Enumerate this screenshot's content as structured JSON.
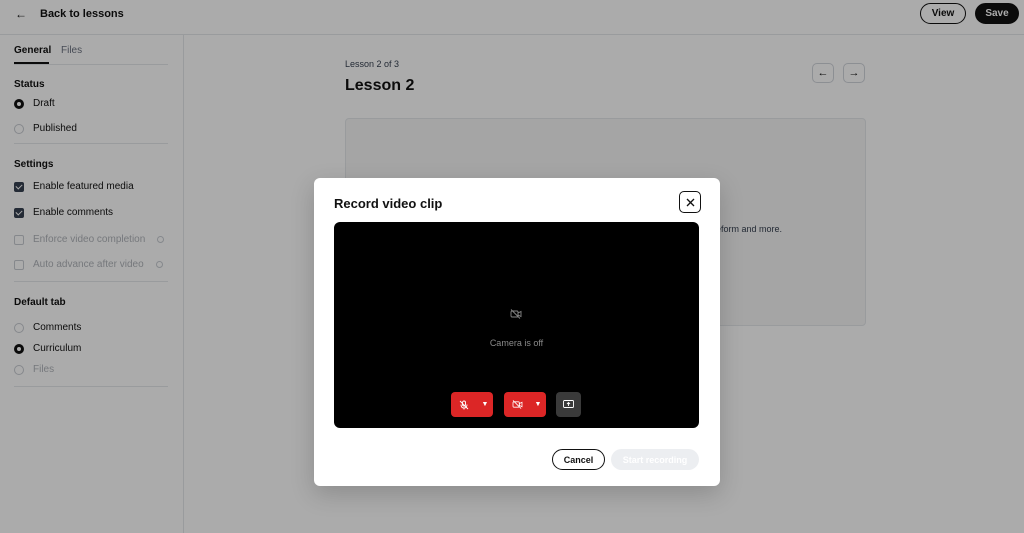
{
  "header": {
    "back_label": "Back to lessons",
    "view_label": "View",
    "save_label": "Save"
  },
  "sidebar": {
    "tabs": [
      {
        "label": "General",
        "active": true
      },
      {
        "label": "Files",
        "active": false
      }
    ],
    "status": {
      "title": "Status",
      "options": [
        {
          "label": "Draft",
          "selected": true
        },
        {
          "label": "Published",
          "selected": false
        }
      ]
    },
    "settings": {
      "title": "Settings",
      "options": [
        {
          "label": "Enable featured media",
          "checked": true,
          "disabled": false
        },
        {
          "label": "Enable comments",
          "checked": true,
          "disabled": false
        },
        {
          "label": "Enforce video completion",
          "checked": false,
          "disabled": true
        },
        {
          "label": "Auto advance after video",
          "checked": false,
          "disabled": true
        }
      ]
    },
    "default_tab": {
      "title": "Default tab",
      "options": [
        {
          "label": "Comments",
          "selected": false,
          "disabled": false
        },
        {
          "label": "Curriculum",
          "selected": true,
          "disabled": false
        },
        {
          "label": "Files",
          "selected": false,
          "disabled": true
        }
      ]
    }
  },
  "main": {
    "lesson_count": "Lesson 2 of 3",
    "lesson_title": "Lesson 2",
    "media_partial_text": "eform and more."
  },
  "modal": {
    "title": "Record video clip",
    "camera_status": "Camera is off",
    "cancel_label": "Cancel",
    "start_label": "Start recording"
  },
  "colors": {
    "accent_dark": "#111111",
    "control_red": "#dc2626",
    "overlay": "rgba(0,0,0,0.33)"
  }
}
